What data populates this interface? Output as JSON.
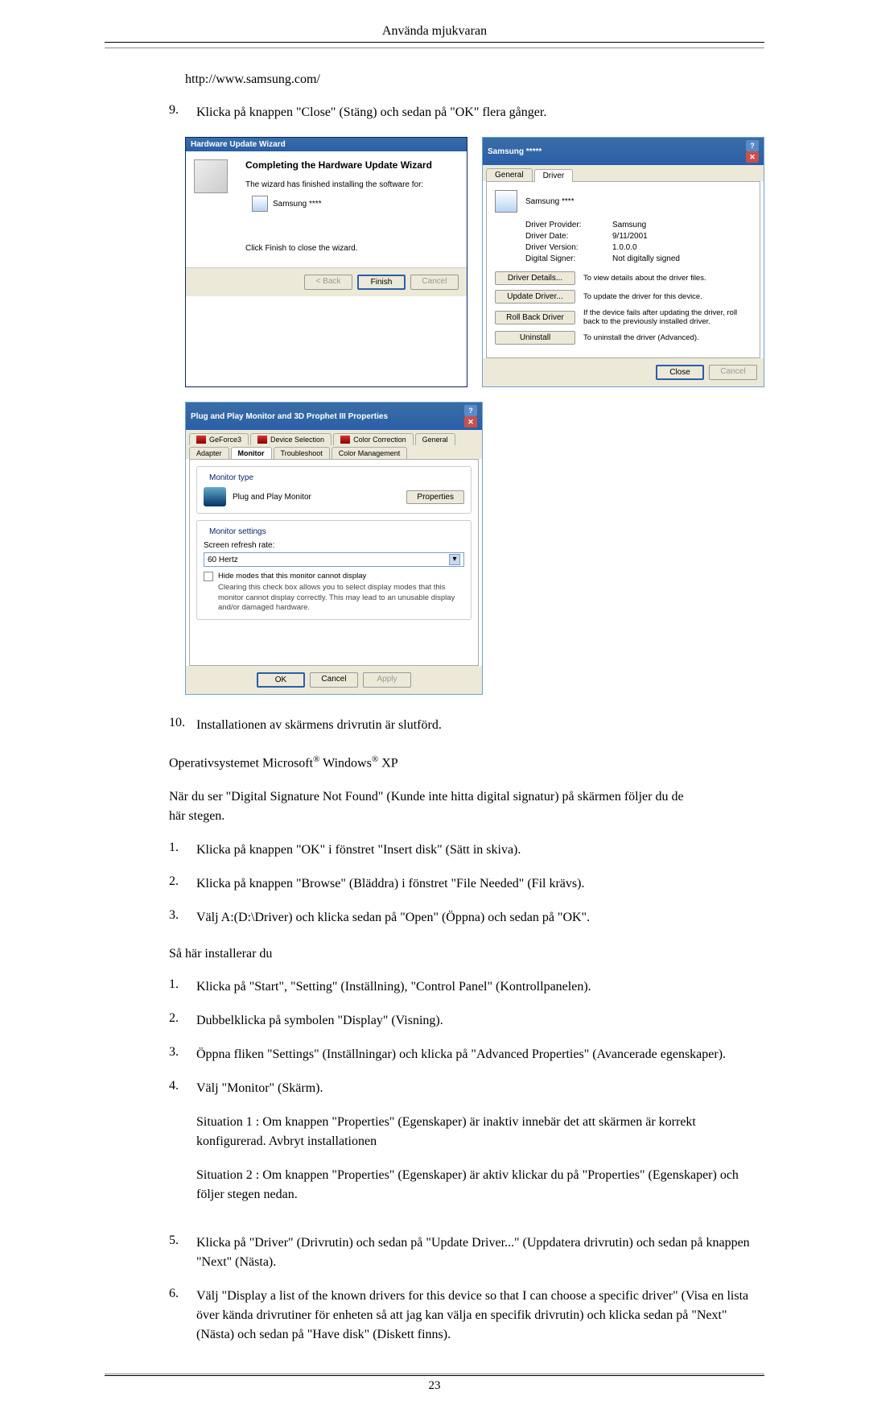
{
  "header": "Använda mjukvaran",
  "line_url": "http://www.samsung.com/",
  "item9": {
    "num": "9.",
    "text": "Klicka på knappen \"Close\" (Stäng) och sedan på \"OK\" flera gånger."
  },
  "wiz": {
    "title": "Hardware Update Wizard",
    "heading": "Completing the Hardware Update Wizard",
    "line1": "The wizard has finished installing the software for:",
    "device": "Samsung ****",
    "line2": "Click Finish to close the wizard.",
    "back": "< Back",
    "finish": "Finish",
    "cancel": "Cancel"
  },
  "drv": {
    "title": "Samsung *****",
    "tab_general": "General",
    "tab_driver": "Driver",
    "name": "Samsung ****",
    "k1": "Driver Provider:",
    "v1": "Samsung",
    "k2": "Driver Date:",
    "v2": "9/11/2001",
    "k3": "Driver Version:",
    "v3": "1.0.0.0",
    "k4": "Digital Signer:",
    "v4": "Not digitally signed",
    "b1": "Driver Details...",
    "d1": "To view details about the driver files.",
    "b2": "Update Driver...",
    "d2": "To update the driver for this device.",
    "b3": "Roll Back Driver",
    "d3": "If the device fails after updating the driver, roll back to the previously installed driver.",
    "b4": "Uninstall",
    "d4": "To uninstall the driver (Advanced).",
    "close": "Close",
    "cancel": "Cancel"
  },
  "mon": {
    "title": "Plug and Play Monitor and 3D Prophet III Properties",
    "t1": "GeForce3",
    "t2": "Device Selection",
    "t3": "Color Correction",
    "t4": "General",
    "t5": "Adapter",
    "t6": "Monitor",
    "t7": "Troubleshoot",
    "t8": "Color Management",
    "grp1": "Monitor type",
    "name": "Plug and Play Monitor",
    "prop": "Properties",
    "grp2": "Monitor settings",
    "lbl": "Screen refresh rate:",
    "val": "60 Hertz",
    "cb1": "Hide modes that this monitor cannot display",
    "cb2": "Clearing this check box allows you to select display modes that this monitor cannot display correctly. This may lead to an unusable display and/or damaged hardware.",
    "ok": "OK",
    "cancel": "Cancel",
    "apply": "Apply"
  },
  "item10": {
    "num": "10.",
    "text": "Installationen av skärmens drivrutin är slutförd."
  },
  "os_line_pre": "Operativsystemet Microsoft",
  "os_line_post": " Windows",
  "os_xp": " XP",
  "reg": "®",
  "intro": "När du ser \"Digital Signature Not Found\" (Kunde inte hitta digital signatur) på skärmen följer du de här stegen.",
  "l1": {
    "n": "1.",
    "t": "Klicka på knappen \"OK\" i fönstret \"Insert disk\" (Sätt in skiva)."
  },
  "l2": {
    "n": "2.",
    "t": "Klicka på knappen \"Browse\" (Bläddra) i fönstret \"File Needed\" (Fil krävs)."
  },
  "l3": {
    "n": "3.",
    "t": "Välj A:(D:\\Driver) och klicka sedan på \"Open\" (Öppna) och sedan på \"OK\"."
  },
  "sahar": "Så här installerar du",
  "s1": {
    "n": "1.",
    "t": "Klicka på \"Start\", \"Setting\" (Inställning), \"Control Panel\" (Kontrollpanelen)."
  },
  "s2": {
    "n": "2.",
    "t": "Dubbelklicka på symbolen \"Display\" (Visning)."
  },
  "s3": {
    "n": "3.",
    "t": "Öppna fliken \"Settings\" (Inställningar) och klicka på \"Advanced Properties\" (Avancerade egenskaper)."
  },
  "s4": {
    "n": "4.",
    "t": "Välj \"Monitor\" (Skärm).",
    "p1": "Situation 1 : Om knappen \"Properties\" (Egenskaper) är inaktiv innebär det att skärmen är korrekt konfigurerad. Avbryt installationen",
    "p2": "Situation 2 : Om knappen \"Properties\" (Egenskaper) är aktiv klickar du på \"Properties\" (Egenskaper) och följer stegen nedan."
  },
  "s5": {
    "n": "5.",
    "t": "Klicka på \"Driver\" (Drivrutin) och sedan på \"Update Driver...\" (Uppdatera drivrutin) och sedan på knappen \"Next\" (Nästa)."
  },
  "s6": {
    "n": "6.",
    "t": "Välj \"Display a list of the known drivers for this device so that I can choose a specific driver\" (Visa en lista över kända drivrutiner för enheten så att jag kan välja en specifik drivrutin) och klicka sedan på \"Next\" (Nästa) och sedan på \"Have disk\" (Diskett finns)."
  },
  "pagenum": "23"
}
